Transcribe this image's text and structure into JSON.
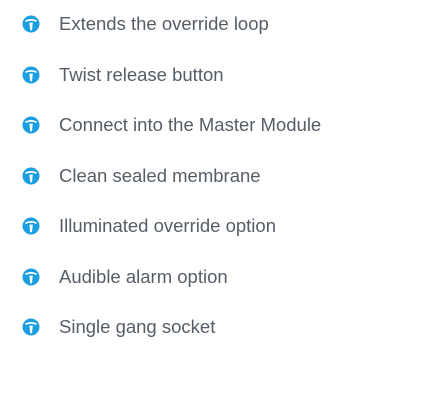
{
  "features": {
    "icon": "info-icon",
    "icon_color": "#1b9fe0",
    "text_color": "#555d66",
    "items": [
      {
        "label": "Extends the override loop"
      },
      {
        "label": "Twist release button"
      },
      {
        "label": "Connect into the Master Module"
      },
      {
        "label": "Clean sealed membrane"
      },
      {
        "label": "Illuminated override option"
      },
      {
        "label": "Audible alarm option"
      },
      {
        "label": "Single gang socket"
      }
    ]
  }
}
